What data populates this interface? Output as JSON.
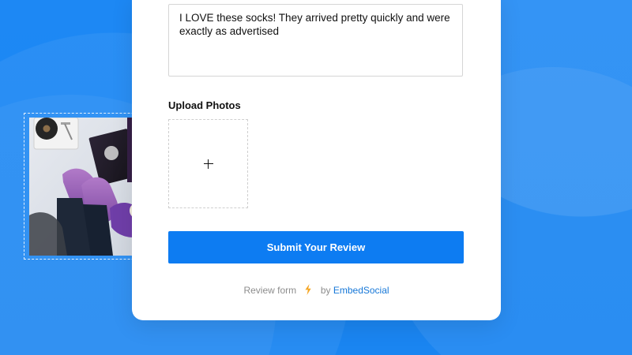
{
  "card": {
    "review_text": "I LOVE these socks! They arrived pretty quickly and were exactly as advertised",
    "upload_label": "Upload Photos",
    "submit_label": "Submit Your Review"
  },
  "footer": {
    "prefix": "Review form",
    "middle": "by",
    "brand": "EmbedSocial"
  },
  "icons": {
    "upload": "plus-icon",
    "footer": "lightning-bolt-icon"
  },
  "preview_photo": {
    "alt": "Photo of purple socks, a record player, and records on a bed"
  },
  "colors": {
    "background": "#1b86f2",
    "button": "#0d7cf2",
    "brand": "#1778d8",
    "bolt": "#f5a623"
  }
}
